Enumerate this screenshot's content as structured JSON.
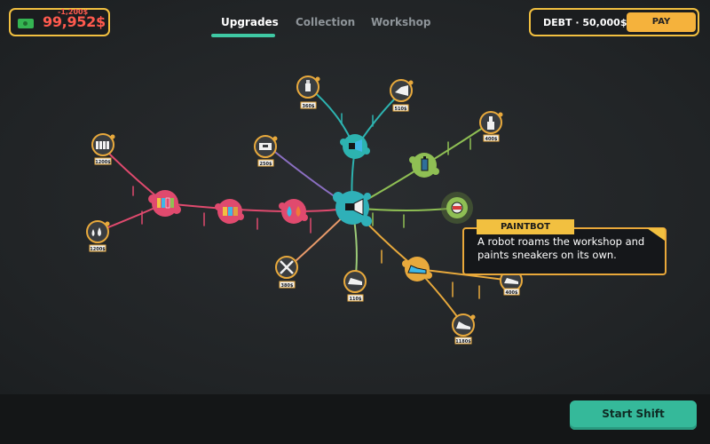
{
  "header": {
    "money": {
      "value": "99,952$",
      "delta": "-1,200$",
      "icon": "cash-icon"
    },
    "tabs": [
      {
        "label": "Upgrades",
        "active": true
      },
      {
        "label": "Collection",
        "active": false
      },
      {
        "label": "Workshop",
        "active": false
      }
    ],
    "debt": {
      "label": "DEBT · 50,000$",
      "pay_label": "PAY"
    }
  },
  "colors": {
    "accent_gold": "#f2c040",
    "tab_active": "#3fc9a4",
    "center_node": "#2fb0b8",
    "branch_pink": "#e04a6e",
    "branch_teal": "#2db3b0",
    "branch_green": "#8fbf54",
    "branch_orange": "#e8a93c",
    "branch_purple": "#8b6fc2",
    "start_button": "#35b99a"
  },
  "tree": {
    "locked_nodes": [
      {
        "id": "spray-can",
        "icon": "spray-can-icon",
        "price": "360$"
      },
      {
        "id": "airbrush",
        "icon": "airbrush-icon",
        "price": "510$"
      },
      {
        "id": "glue-bottle",
        "icon": "glue-bottle-icon",
        "price": "400$"
      },
      {
        "id": "paint-rack",
        "icon": "paint-rack-icon",
        "price": "1200$"
      },
      {
        "id": "drops",
        "icon": "drops-icon",
        "price": "1200$"
      },
      {
        "id": "shoebox",
        "icon": "shoebox-icon",
        "price": "250$"
      },
      {
        "id": "fan",
        "icon": "fan-icon",
        "price": "380$"
      },
      {
        "id": "sneaker-stand",
        "icon": "sneaker-stand-icon",
        "price": "110$"
      },
      {
        "id": "sneaker-pair",
        "icon": "sneaker-pair-icon",
        "price": "400$"
      },
      {
        "id": "heel-shoe",
        "icon": "heel-shoe-icon",
        "price": "1180$"
      }
    ],
    "owned_nodes": [
      {
        "id": "center",
        "icon": "spray-gun-icon"
      },
      {
        "id": "paint-cans-1",
        "icon": "paint-cans-icon"
      },
      {
        "id": "paint-cans-2",
        "icon": "paint-cans-icon"
      },
      {
        "id": "paint-drops",
        "icon": "paint-drops-icon"
      },
      {
        "id": "spray-upgrade",
        "icon": "spray-gun-icon"
      },
      {
        "id": "bottle-upgrade",
        "icon": "bottle-icon"
      },
      {
        "id": "sneaker-upgrade",
        "icon": "sneaker-icon"
      },
      {
        "id": "paintbot",
        "icon": "robot-icon"
      }
    ]
  },
  "tooltip": {
    "title": "PAINTBOT",
    "description": "A robot roams the workshop and paints sneakers on its own."
  },
  "footer": {
    "start_label": "Start Shift"
  }
}
